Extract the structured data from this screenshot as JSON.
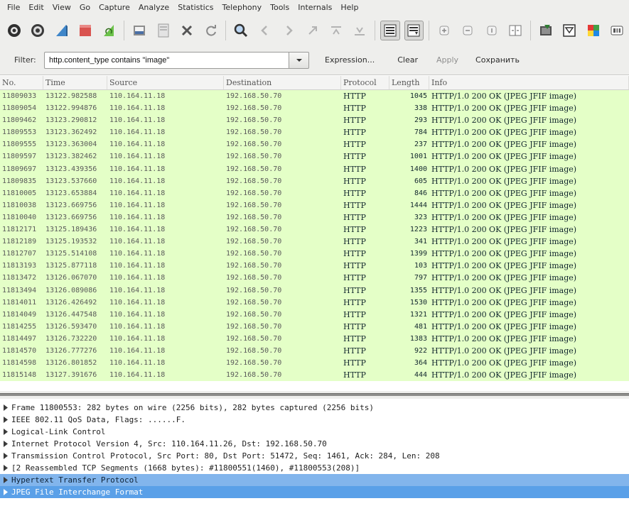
{
  "menu": [
    "File",
    "Edit",
    "View",
    "Go",
    "Capture",
    "Analyze",
    "Statistics",
    "Telephony",
    "Tools",
    "Internals",
    "Help"
  ],
  "toolbar": {
    "icons": [
      "capture-interfaces-icon",
      "capture-options-icon",
      "start-capture-icon",
      "stop-capture-icon",
      "restart-capture-icon",
      "open-file-icon",
      "save-file-icon",
      "close-file-icon",
      "reload-file-icon",
      "find-packet-icon",
      "go-back-icon",
      "go-forward-icon",
      "go-to-packet-icon",
      "go-first-packet-icon",
      "go-last-packet-icon",
      "colorize-icon",
      "auto-scroll-icon",
      "zoom-in-icon",
      "zoom-out-icon",
      "zoom-normal-icon",
      "resize-columns-icon",
      "capture-filters-icon",
      "display-filters-icon",
      "coloring-rules-icon",
      "preferences-icon"
    ]
  },
  "filter": {
    "label": "Filter:",
    "value": "http.content_type contains \"image\"",
    "expression": "Expression...",
    "clear": "Clear",
    "apply": "Apply",
    "save": "Сохранить"
  },
  "columns": {
    "no": "No.",
    "time": "Time",
    "source": "Source",
    "destination": "Destination",
    "protocol": "Protocol",
    "length": "Length",
    "info": "Info"
  },
  "colors": {
    "row_bg": "#e4ffc7",
    "selected_row": "#82b5ec"
  },
  "packets": [
    {
      "no": "11809033",
      "time": "13122.982588",
      "src": "110.164.11.18",
      "dst": "192.168.50.70",
      "proto": "HTTP",
      "len": "1045",
      "info": "HTTP/1.0 200 OK  (JPEG JFIF image)"
    },
    {
      "no": "11809054",
      "time": "13122.994876",
      "src": "110.164.11.18",
      "dst": "192.168.50.70",
      "proto": "HTTP",
      "len": "338",
      "info": "HTTP/1.0 200 OK  (JPEG JFIF image)"
    },
    {
      "no": "11809462",
      "time": "13123.290812",
      "src": "110.164.11.18",
      "dst": "192.168.50.70",
      "proto": "HTTP",
      "len": "293",
      "info": "HTTP/1.0 200 OK  (JPEG JFIF image)"
    },
    {
      "no": "11809553",
      "time": "13123.362492",
      "src": "110.164.11.18",
      "dst": "192.168.50.70",
      "proto": "HTTP",
      "len": "784",
      "info": "HTTP/1.0 200 OK  (JPEG JFIF image)"
    },
    {
      "no": "11809555",
      "time": "13123.363004",
      "src": "110.164.11.18",
      "dst": "192.168.50.70",
      "proto": "HTTP",
      "len": "237",
      "info": "HTTP/1.0 200 OK  (JPEG JFIF image)"
    },
    {
      "no": "11809597",
      "time": "13123.382462",
      "src": "110.164.11.18",
      "dst": "192.168.50.70",
      "proto": "HTTP",
      "len": "1001",
      "info": "HTTP/1.0 200 OK  (JPEG JFIF image)"
    },
    {
      "no": "11809697",
      "time": "13123.439356",
      "src": "110.164.11.18",
      "dst": "192.168.50.70",
      "proto": "HTTP",
      "len": "1400",
      "info": "HTTP/1.0 200 OK  (JPEG JFIF image)"
    },
    {
      "no": "11809835",
      "time": "13123.537660",
      "src": "110.164.11.18",
      "dst": "192.168.50.70",
      "proto": "HTTP",
      "len": "605",
      "info": "HTTP/1.0 200 OK  (JPEG JFIF image)"
    },
    {
      "no": "11810005",
      "time": "13123.653884",
      "src": "110.164.11.18",
      "dst": "192.168.50.70",
      "proto": "HTTP",
      "len": "846",
      "info": "HTTP/1.0 200 OK  (JPEG JFIF image)"
    },
    {
      "no": "11810038",
      "time": "13123.669756",
      "src": "110.164.11.18",
      "dst": "192.168.50.70",
      "proto": "HTTP",
      "len": "1444",
      "info": "HTTP/1.0 200 OK  (JPEG JFIF image)"
    },
    {
      "no": "11810040",
      "time": "13123.669756",
      "src": "110.164.11.18",
      "dst": "192.168.50.70",
      "proto": "HTTP",
      "len": "323",
      "info": "HTTP/1.0 200 OK  (JPEG JFIF image)"
    },
    {
      "no": "11812171",
      "time": "13125.189436",
      "src": "110.164.11.18",
      "dst": "192.168.50.70",
      "proto": "HTTP",
      "len": "1223",
      "info": "HTTP/1.0 200 OK  (JPEG JFIF image)"
    },
    {
      "no": "11812189",
      "time": "13125.193532",
      "src": "110.164.11.18",
      "dst": "192.168.50.70",
      "proto": "HTTP",
      "len": "341",
      "info": "HTTP/1.0 200 OK  (JPEG JFIF image)"
    },
    {
      "no": "11812707",
      "time": "13125.514108",
      "src": "110.164.11.18",
      "dst": "192.168.50.70",
      "proto": "HTTP",
      "len": "1399",
      "info": "HTTP/1.0 200 OK  (JPEG JFIF image)"
    },
    {
      "no": "11813193",
      "time": "13125.877118",
      "src": "110.164.11.18",
      "dst": "192.168.50.70",
      "proto": "HTTP",
      "len": "103",
      "info": "HTTP/1.0 200 OK  (JPEG JFIF image)"
    },
    {
      "no": "11813472",
      "time": "13126.067070",
      "src": "110.164.11.18",
      "dst": "192.168.50.70",
      "proto": "HTTP",
      "len": "797",
      "info": "HTTP/1.0 200 OK  (JPEG JFIF image)"
    },
    {
      "no": "11813494",
      "time": "13126.089086",
      "src": "110.164.11.18",
      "dst": "192.168.50.70",
      "proto": "HTTP",
      "len": "1355",
      "info": "HTTP/1.0 200 OK  (JPEG JFIF image)"
    },
    {
      "no": "11814011",
      "time": "13126.426492",
      "src": "110.164.11.18",
      "dst": "192.168.50.70",
      "proto": "HTTP",
      "len": "1530",
      "info": "HTTP/1.0 200 OK  (JPEG JFIF image)"
    },
    {
      "no": "11814049",
      "time": "13126.447548",
      "src": "110.164.11.18",
      "dst": "192.168.50.70",
      "proto": "HTTP",
      "len": "1321",
      "info": "HTTP/1.0 200 OK  (JPEG JFIF image)"
    },
    {
      "no": "11814255",
      "time": "13126.593470",
      "src": "110.164.11.18",
      "dst": "192.168.50.70",
      "proto": "HTTP",
      "len": "481",
      "info": "HTTP/1.0 200 OK  (JPEG JFIF image)"
    },
    {
      "no": "11814497",
      "time": "13126.732220",
      "src": "110.164.11.18",
      "dst": "192.168.50.70",
      "proto": "HTTP",
      "len": "1383",
      "info": "HTTP/1.0 200 OK  (JPEG JFIF image)"
    },
    {
      "no": "11814570",
      "time": "13126.777276",
      "src": "110.164.11.18",
      "dst": "192.168.50.70",
      "proto": "HTTP",
      "len": "922",
      "info": "HTTP/1.0 200 OK  (JPEG JFIF image)"
    },
    {
      "no": "11814598",
      "time": "13126.801852",
      "src": "110.164.11.18",
      "dst": "192.168.50.70",
      "proto": "HTTP",
      "len": "364",
      "info": "HTTP/1.0 200 OK  (JPEG JFIF image)"
    },
    {
      "no": "11815148",
      "time": "13127.391676",
      "src": "110.164.11.18",
      "dst": "192.168.50.70",
      "proto": "HTTP",
      "len": "444",
      "info": "HTTP/1.0 200 OK  (JPEG JFIF image)"
    }
  ],
  "details": [
    {
      "text": "Frame 11800553: 282 bytes on wire (2256 bits), 282 bytes captured (2256 bits)",
      "selected": ""
    },
    {
      "text": "IEEE 802.11 QoS Data, Flags: ......F.",
      "selected": ""
    },
    {
      "text": "Logical-Link Control",
      "selected": ""
    },
    {
      "text": "Internet Protocol Version 4, Src: 110.164.11.26, Dst: 192.168.50.70",
      "selected": ""
    },
    {
      "text": "Transmission Control Protocol, Src Port: 80, Dst Port: 51472, Seq: 1461, Ack: 284, Len: 208",
      "selected": ""
    },
    {
      "text": "[2 Reassembled TCP Segments (1668 bytes): #11800551(1460), #11800553(208)]",
      "selected": ""
    },
    {
      "text": "Hypertext Transfer Protocol",
      "selected": "sel"
    },
    {
      "text": "JPEG File Interchange Format",
      "selected": "sel2"
    }
  ]
}
